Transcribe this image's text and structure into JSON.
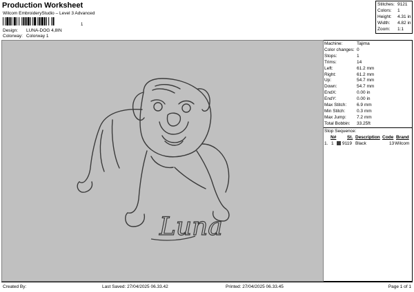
{
  "header": {
    "title": "Production Worksheet",
    "subtitle": "Wilcom EmbroideryStudio – Level 3 Advanced",
    "barcode_suffix": "1",
    "design_label": "Design:",
    "design_value": "LUNA-DOG 4,8IN",
    "colorway_label": "Colorway:",
    "colorway_value": "Colorway 1"
  },
  "stats": [
    {
      "label": "Stitches:",
      "value": "9121"
    },
    {
      "label": "Colors:",
      "value": "1"
    },
    {
      "label": "Height:",
      "value": "4.31 in"
    },
    {
      "label": "Width:",
      "value": "4.82 in"
    },
    {
      "label": "Zoom:",
      "value": "1:1"
    }
  ],
  "canvas": {
    "design_text": "Luna",
    "thread_color": "#3a3a3a",
    "background_color": "#c0c0c0"
  },
  "machine_info": [
    {
      "label": "Machine:",
      "value": "Tajima"
    },
    {
      "label": "Color changes:",
      "value": "0"
    },
    {
      "label": "Stops:",
      "value": "1"
    },
    {
      "label": "Trims:",
      "value": "14"
    },
    {
      "label": "Left:",
      "value": "61.2 mm"
    },
    {
      "label": "Right:",
      "value": "61.2 mm"
    },
    {
      "label": "Up:",
      "value": "54.7 mm"
    },
    {
      "label": "Down:",
      "value": "54.7 mm"
    },
    {
      "label": "EndX:",
      "value": "0.00 in"
    },
    {
      "label": "EndY:",
      "value": "0.00 in"
    },
    {
      "label": "Max Stitch:",
      "value": "6.9 mm"
    },
    {
      "label": "Min Stitch:",
      "value": "0.3 mm"
    },
    {
      "label": "Max Jump:",
      "value": "7.2 mm"
    },
    {
      "label": "Total Bobbin:",
      "value": "33.25ft"
    }
  ],
  "stop_sequence": {
    "title": "Stop Sequence:",
    "columns": [
      "N#",
      "St.",
      "Description",
      "Code",
      "Brand"
    ],
    "rows": [
      {
        "index": "1.",
        "n": "1",
        "stitches": "9119",
        "description": "Black",
        "code": "13",
        "brand": "Wilcom"
      }
    ]
  },
  "footer": {
    "created_by": "Created By:",
    "last_saved": "Last Saved: 27/04/2025 06.33.42",
    "printed": "Printed: 27/04/2025 06.33.45",
    "page": "Page 1 of 1"
  }
}
